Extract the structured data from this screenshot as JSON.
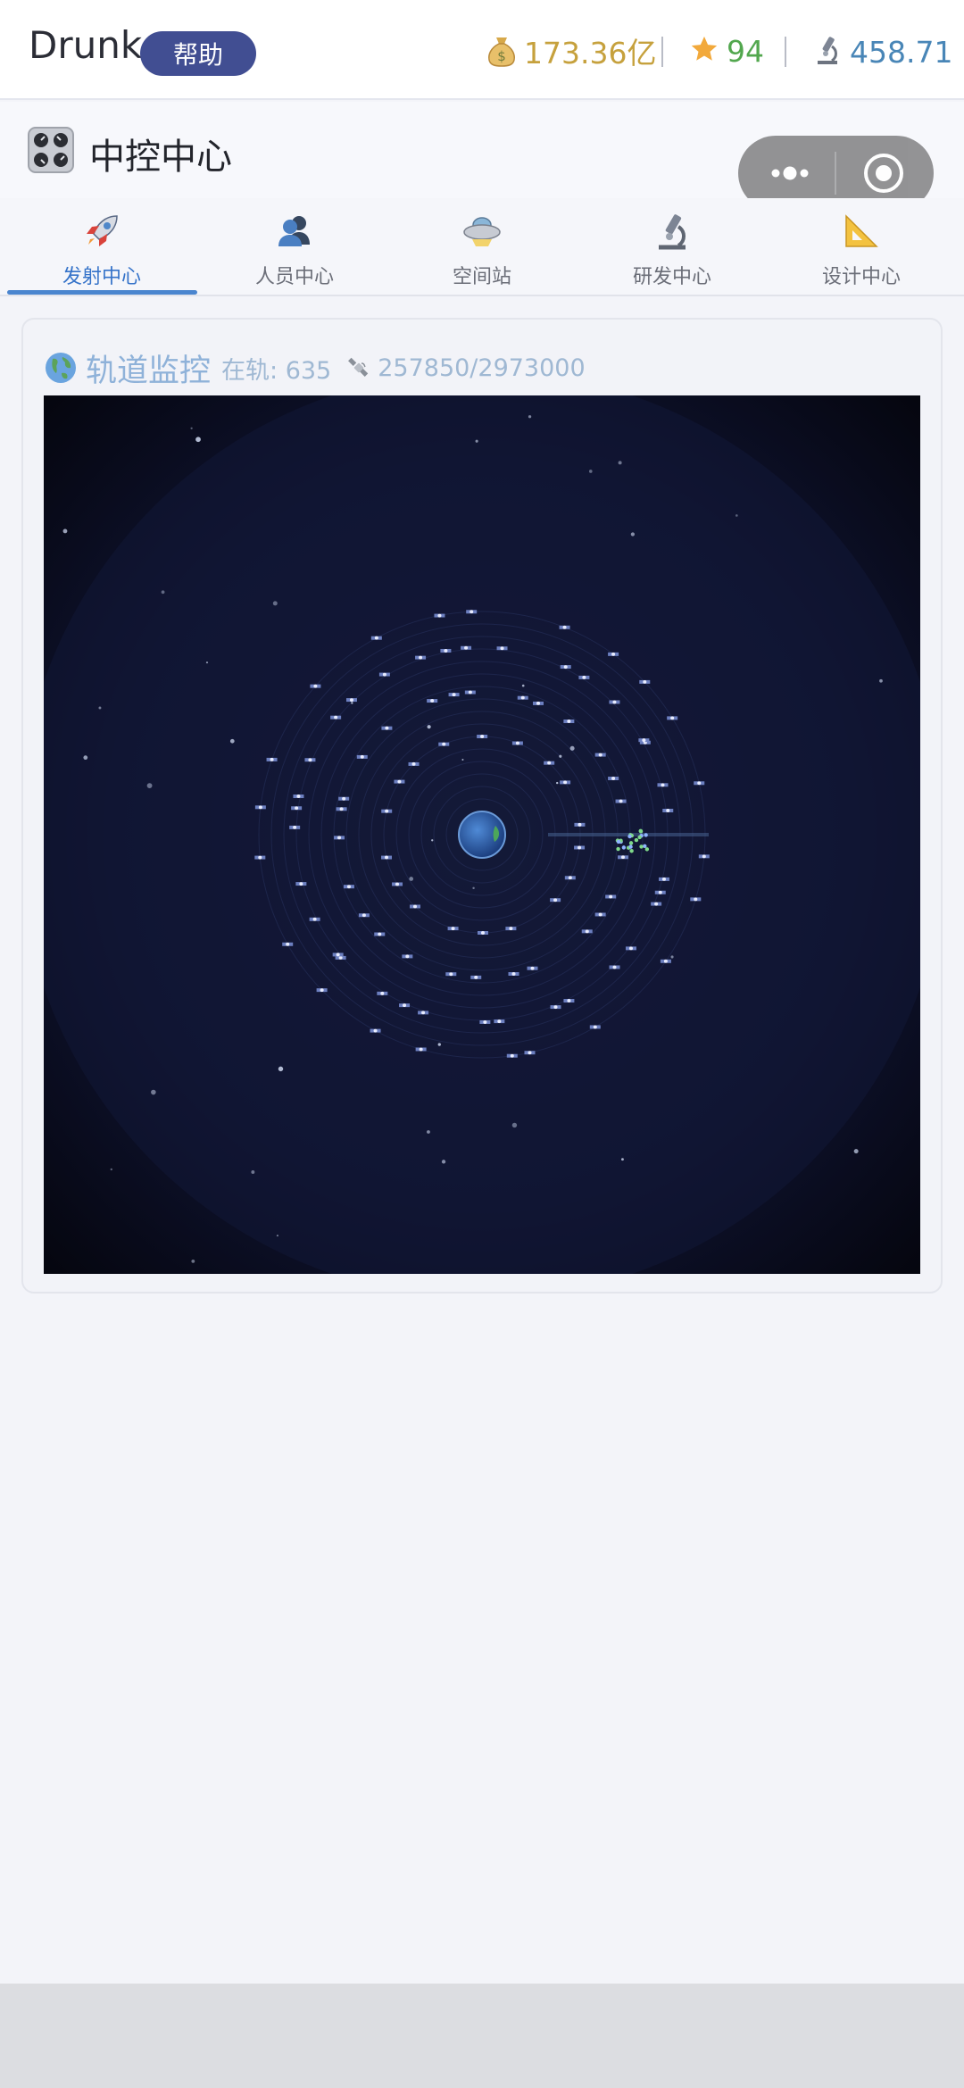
{
  "header": {
    "brand": "Drunk",
    "help_label": "帮助",
    "money": "173.36亿",
    "stars": "94",
    "research": "458.71"
  },
  "page": {
    "title": "中控中心"
  },
  "tabs": [
    {
      "label": "发射中心",
      "icon": "rocket-icon",
      "active": true
    },
    {
      "label": "人员中心",
      "icon": "people-icon",
      "active": false
    },
    {
      "label": "空间站",
      "icon": "ufo-icon",
      "active": false
    },
    {
      "label": "研发中心",
      "icon": "microscope-icon",
      "active": false
    },
    {
      "label": "设计中心",
      "icon": "ruler-icon",
      "active": false
    }
  ],
  "orbit_panel": {
    "title": "轨道监控",
    "in_orbit_label": "在轨: 635",
    "capacity": "257850/2973000"
  },
  "colors": {
    "accent": "#4a85cf",
    "help_button": "#414e92",
    "money": "#c6a13d",
    "stars": "#52a74e",
    "research": "#4986b7",
    "space_bg": "#0b0d1d"
  }
}
